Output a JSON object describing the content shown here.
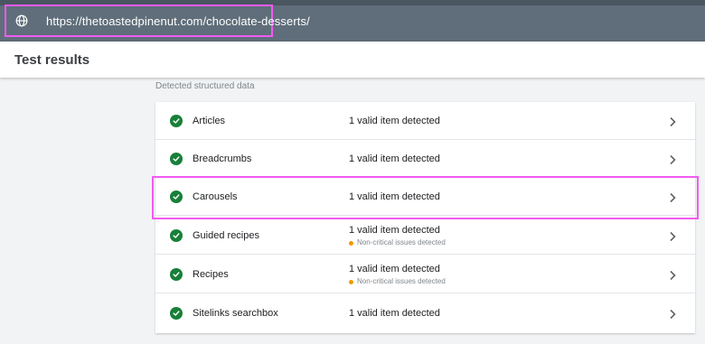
{
  "url_bar": {
    "url": "https://thetoastedpinenut.com/chocolate-desserts/",
    "icon": "globe-icon"
  },
  "header": {
    "title": "Test results"
  },
  "section": {
    "label": "Detected structured data"
  },
  "rows": [
    {
      "name": "Articles",
      "status": "1 valid item detected",
      "sub": ""
    },
    {
      "name": "Breadcrumbs",
      "status": "1 valid item detected",
      "sub": ""
    },
    {
      "name": "Carousels",
      "status": "1 valid item detected",
      "sub": ""
    },
    {
      "name": "Guided recipes",
      "status": "1 valid item detected",
      "sub": "Non-critical issues detected"
    },
    {
      "name": "Recipes",
      "status": "1 valid item detected",
      "sub": "Non-critical issues detected"
    },
    {
      "name": "Sitelinks searchbox",
      "status": "1 valid item detected",
      "sub": ""
    }
  ],
  "colors": {
    "check_green": "#188038",
    "warning_orange": "#f29900",
    "highlight_magenta": "#f25af2",
    "topbar": "#5f6e7a"
  }
}
